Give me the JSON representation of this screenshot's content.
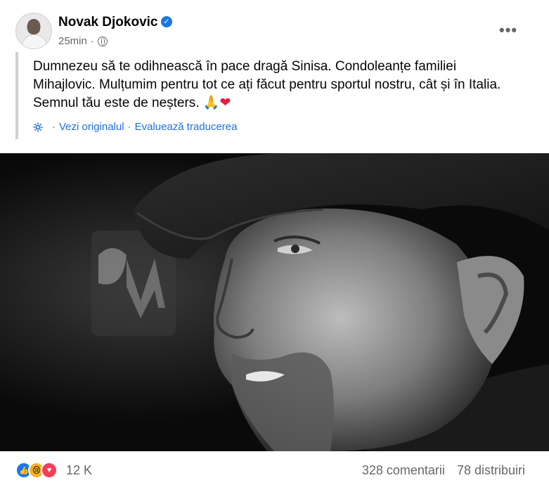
{
  "post": {
    "author": "Novak Djokovic",
    "time": "25min",
    "text_line1": "Dumnezeu să te odihnească în pace dragă Sinisa. Condoleanțe familiei",
    "text_line2": "Mihajlovic. Mulțumim pentru tot ce ați făcut pentru sportul nostru, cât și în Italia.",
    "text_line3": "Semnul tău este de neșters.",
    "see_original": "Vezi originalul",
    "rate_translation": "Evaluează traducerea"
  },
  "footer": {
    "reaction_count": "12 K",
    "comments": "328 comentarii",
    "shares": "78 distribuiri"
  },
  "colors": {
    "accent": "#1877f2",
    "link": "#216fdb",
    "muted": "#65676b"
  }
}
